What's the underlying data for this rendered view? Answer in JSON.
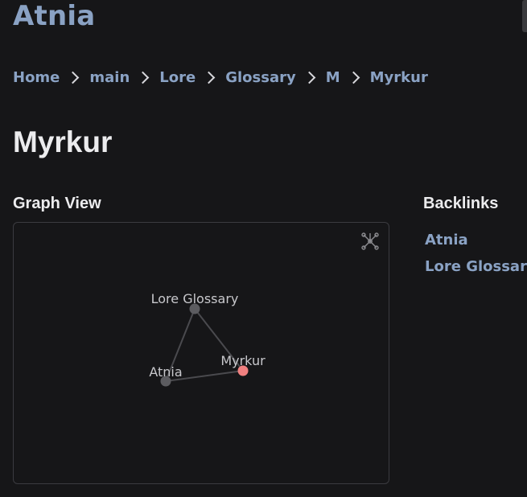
{
  "site": {
    "title": "Atnia"
  },
  "breadcrumb": [
    "Home",
    "main",
    "Lore",
    "Glossary",
    "M",
    "Myrkur"
  ],
  "page": {
    "title": "Myrkur"
  },
  "graph": {
    "heading": "Graph View",
    "button_icon": "global-graph-icon",
    "nodes": [
      {
        "id": "lore-glossary",
        "label": "Lore Glossary",
        "color": "#5c5c60"
      },
      {
        "id": "atnia",
        "label": "Atnia",
        "color": "#5c5c60"
      },
      {
        "id": "myrkur",
        "label": "Myrkur",
        "color": "#f08080",
        "current": true
      }
    ],
    "edges": [
      [
        "lore-glossary",
        "atnia"
      ],
      [
        "lore-glossary",
        "myrkur"
      ],
      [
        "atnia",
        "myrkur"
      ]
    ]
  },
  "backlinks": {
    "heading": "Backlinks",
    "items": [
      "Atnia",
      "Lore Glossary"
    ]
  },
  "colors": {
    "background": "#161618",
    "link": "#8aa2c4",
    "text": "#ececee",
    "current_node": "#f08080",
    "node": "#5c5c60",
    "edge": "#4a4a4e"
  }
}
